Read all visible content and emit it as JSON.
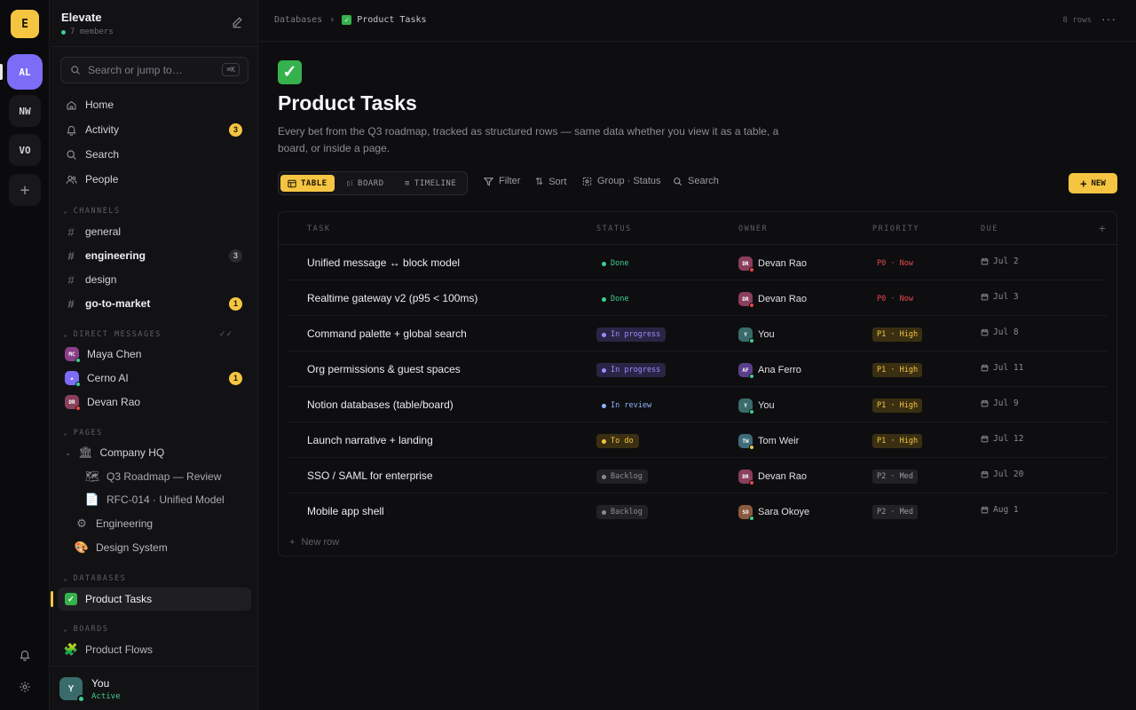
{
  "rail": {
    "workspaces": [
      {
        "label": "E",
        "color": "#f5c542"
      },
      {
        "label": "AL",
        "color": "#7c6cf6"
      },
      {
        "label": "NW",
        "color": "#18181b"
      },
      {
        "label": "VO",
        "color": "#18181b"
      }
    ]
  },
  "workspace": {
    "name": "Elevate",
    "members": "7 members"
  },
  "search": {
    "placeholder": "Search or jump to…",
    "shortcut": "⌘K"
  },
  "nav": [
    {
      "label": "Home",
      "icon": "home-icon"
    },
    {
      "label": "Activity",
      "icon": "bell-icon",
      "badge": "3"
    },
    {
      "label": "Search",
      "icon": "search-icon"
    },
    {
      "label": "People",
      "icon": "people-icon"
    }
  ],
  "channels": {
    "heading": "CHANNELS",
    "items": [
      {
        "label": "general"
      },
      {
        "label": "engineering",
        "badge": "3"
      },
      {
        "label": "design"
      },
      {
        "label": "go-to-market",
        "badge": "1"
      }
    ]
  },
  "dms": {
    "heading": "DIRECT MESSAGES",
    "items": [
      {
        "label": "Maya Chen",
        "initials": "MC",
        "color": "#8a3f8a",
        "status": "#3ecf8e"
      },
      {
        "label": "Cerno AI",
        "initials": "✦",
        "color": "#7c6cf6",
        "status": "#3ecf8e",
        "badge": "1"
      },
      {
        "label": "Devan Rao",
        "initials": "DR",
        "color": "#8a3f5a",
        "status": "#e5484d"
      }
    ]
  },
  "pages": {
    "heading": "PAGES",
    "items": [
      {
        "label": "Company HQ",
        "icon": "🏛"
      },
      {
        "label": "Q3 Roadmap — Review",
        "icon": "🗺"
      },
      {
        "label": "RFC-014 · Unified Model",
        "icon": "📄"
      },
      {
        "label": "Engineering",
        "icon": "⚙"
      },
      {
        "label": "Design System",
        "icon": "🎨"
      }
    ]
  },
  "databases": {
    "heading": "DATABASES",
    "items": [
      {
        "label": "Product Tasks",
        "icon": "✅"
      }
    ]
  },
  "boards": {
    "heading": "BOARDS",
    "items": [
      {
        "label": "Product Flows",
        "icon": "🧩"
      }
    ]
  },
  "user": {
    "name": "You",
    "status": "Active",
    "initials": "Y"
  },
  "breadcrumb": {
    "parent": "Databases",
    "current": "Product Tasks",
    "emoji": "✅"
  },
  "rows_count": "8 rows",
  "page": {
    "emoji": "✅",
    "title": "Product Tasks",
    "description": "Every bet from the Q3 roadmap, tracked as structured rows — same data whether you view it as a table, a board, or inside a page."
  },
  "views": [
    {
      "label": "TABLE",
      "active": true
    },
    {
      "label": "BOARD"
    },
    {
      "label": "TIMELINE"
    }
  ],
  "toolbar": {
    "filter": "Filter",
    "sort": "Sort",
    "group": "Group · Status",
    "search": "Search",
    "new": "NEW"
  },
  "table": {
    "headers": [
      "TASK",
      "STATUS",
      "OWNER",
      "PRIORITY",
      "DUE"
    ],
    "rows": [
      {
        "task": "Unified message ↔ block model",
        "status": "Done",
        "status_color": "#3ecf8e",
        "status_bg": "transparent",
        "owner": "Devan Rao",
        "owner_initials": "DR",
        "owner_color": "#8a3f5a",
        "owner_status": "#e5484d",
        "priority": "P0 · Now",
        "prio_color": "#e5484d",
        "prio_bg": "transparent",
        "due": "Jul 2"
      },
      {
        "task": "Realtime gateway v2 (p95 < 100ms)",
        "status": "Done",
        "status_color": "#3ecf8e",
        "status_bg": "transparent",
        "owner": "Devan Rao",
        "owner_initials": "DR",
        "owner_color": "#8a3f5a",
        "owner_status": "#e5484d",
        "priority": "P0 · Now",
        "prio_color": "#e5484d",
        "prio_bg": "transparent",
        "due": "Jul 3"
      },
      {
        "task": "Command palette + global search",
        "status": "In progress",
        "status_color": "#9d8cff",
        "status_bg": "#2a2545",
        "owner": "You",
        "owner_initials": "Y",
        "owner_color": "#3a6b6b",
        "owner_status": "#3ecf8e",
        "priority": "P1 · High",
        "prio_color": "#f5c542",
        "prio_bg": "#3a2f12",
        "due": "Jul 8"
      },
      {
        "task": "Org permissions & guest spaces",
        "status": "In progress",
        "status_color": "#9d8cff",
        "status_bg": "#2a2545",
        "owner": "Ana Ferro",
        "owner_initials": "AF",
        "owner_color": "#5a3f8a",
        "owner_status": "#3ecf8e",
        "priority": "P1 · High",
        "prio_color": "#f5c542",
        "prio_bg": "#3a2f12",
        "due": "Jul 11"
      },
      {
        "task": "Notion databases (table/board)",
        "status": "In review",
        "status_color": "#8fb4ff",
        "status_bg": "transparent",
        "owner": "You",
        "owner_initials": "Y",
        "owner_color": "#3a6b6b",
        "owner_status": "#3ecf8e",
        "priority": "P1 · High",
        "prio_color": "#f5c542",
        "prio_bg": "#3a2f12",
        "due": "Jul 9"
      },
      {
        "task": "Launch narrative + landing",
        "status": "To do",
        "status_color": "#f5c542",
        "status_bg": "#3a2f12",
        "owner": "Tom Weir",
        "owner_initials": "TW",
        "owner_color": "#3f6b7a",
        "owner_status": "#f5c542",
        "priority": "P1 · High",
        "prio_color": "#f5c542",
        "prio_bg": "#3a2f12",
        "due": "Jul 12"
      },
      {
        "task": "SSO / SAML for enterprise",
        "status": "Backlog",
        "status_color": "#8b8b93",
        "status_bg": "#222226",
        "owner": "Devan Rao",
        "owner_initials": "DR",
        "owner_color": "#8a3f5a",
        "owner_status": "#e5484d",
        "priority": "P2 · Med",
        "prio_color": "#9a9aa2",
        "prio_bg": "#222226",
        "due": "Jul 20"
      },
      {
        "task": "Mobile app shell",
        "status": "Backlog",
        "status_color": "#8b8b93",
        "status_bg": "#222226",
        "owner": "Sara Okoye",
        "owner_initials": "SO",
        "owner_color": "#8a5a3f",
        "owner_status": "#3ecf8e",
        "priority": "P2 · Med",
        "prio_color": "#9a9aa2",
        "prio_bg": "#222226",
        "due": "Aug 1"
      }
    ],
    "new_row": "New row"
  }
}
